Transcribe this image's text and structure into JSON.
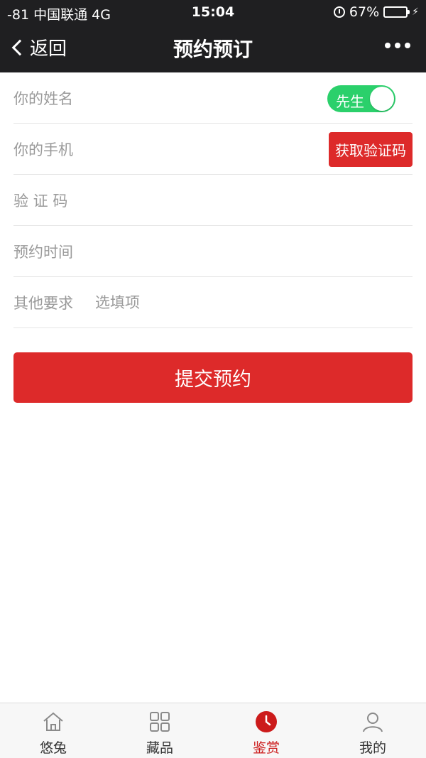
{
  "status_bar": {
    "carrier": "-81 中国联通   4G",
    "time": "15:04",
    "battery": "67%",
    "battery_level": 0.67
  },
  "nav": {
    "back_label": "返回",
    "title": "预约预订",
    "more_icon": "more-dots-icon"
  },
  "form": {
    "name": {
      "label": "你的姓名",
      "value": "",
      "gender_toggle": "先生",
      "gender_on": true
    },
    "phone": {
      "label": "你的手机",
      "value": "",
      "code_button": "获取验证码"
    },
    "code": {
      "label": "验 证 码",
      "value": ""
    },
    "time": {
      "label": "预约时间",
      "value": ""
    },
    "other": {
      "label": "其他要求",
      "placeholder": "选填项",
      "value": ""
    }
  },
  "submit_label": "提交预约",
  "colors": {
    "primary_red": "#dd2a2a",
    "toggle_green": "#2bd06b",
    "nav_bg": "#1f1f21",
    "active_tab": "#cc1b1b"
  },
  "tabs": [
    {
      "label": "悠兔",
      "icon": "home-icon",
      "active": false
    },
    {
      "label": "藏品",
      "icon": "grid-icon",
      "active": false
    },
    {
      "label": "鉴赏",
      "icon": "clock-icon",
      "active": true
    },
    {
      "label": "我的",
      "icon": "user-icon",
      "active": false
    }
  ]
}
